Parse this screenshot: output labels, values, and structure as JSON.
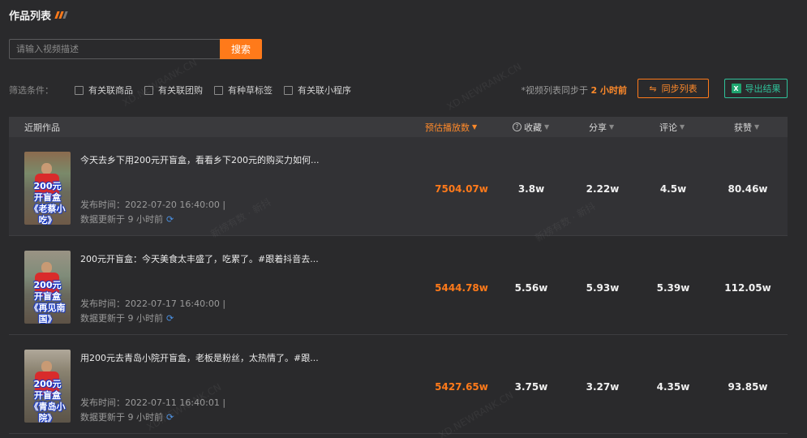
{
  "header": {
    "title": "作品列表"
  },
  "search": {
    "placeholder": "请输入视频描述",
    "button_label": "搜索"
  },
  "filters": {
    "label": "筛选条件：",
    "options": [
      "有关联商品",
      "有关联团购",
      "有种草标签",
      "有关联小程序"
    ],
    "sync_note_prefix": "*视频列表同步于",
    "sync_note_time": "2 小时前",
    "sync_button": "同步列表",
    "export_button": "导出结果"
  },
  "table": {
    "columns": {
      "works": "近期作品",
      "plays": "预估播放数",
      "favorites": "收藏",
      "shares": "分享",
      "comments": "评论",
      "likes": "获赞"
    },
    "rows": [
      {
        "title": "今天去乡下用200元开盲盒，看看乡下200元的购买力如何...",
        "pub_time": "发布时间：2022-07-20 16:40:00  |",
        "updated": "数据更新于 9 小时前",
        "thumb_caption": [
          "200元",
          "开盲盒",
          "《老蔡小吃》"
        ],
        "plays": "7504.07w",
        "favorites": "3.8w",
        "shares": "2.22w",
        "comments": "4.5w",
        "likes": "80.46w"
      },
      {
        "title": "200元开盲盒：今天美食太丰盛了，吃累了。#跟着抖音去...",
        "pub_time": "发布时间：2022-07-17 16:40:00  |",
        "updated": "数据更新于 9 小时前",
        "thumb_caption": [
          "200元",
          "开盲盒",
          "《再见南国》"
        ],
        "plays": "5444.78w",
        "favorites": "5.56w",
        "shares": "5.93w",
        "comments": "5.39w",
        "likes": "112.05w"
      },
      {
        "title": "用200元去青岛小院开盲盒，老板是粉丝，太热情了。#跟...",
        "pub_time": "发布时间：2022-07-11 16:40:01  |",
        "updated": "数据更新于 9 小时前",
        "thumb_caption": [
          "200元",
          "开盲盒",
          "《青岛小院》"
        ],
        "plays": "5427.65w",
        "favorites": "3.75w",
        "shares": "3.27w",
        "comments": "4.35w",
        "likes": "93.85w"
      }
    ]
  },
  "watermarks": [
    "XD.NEWRANK.CN",
    "新榜有数 · 新抖"
  ],
  "colors": {
    "accent": "#ff7a1a",
    "export": "#2fc29a",
    "background": "#2a2a2c"
  }
}
